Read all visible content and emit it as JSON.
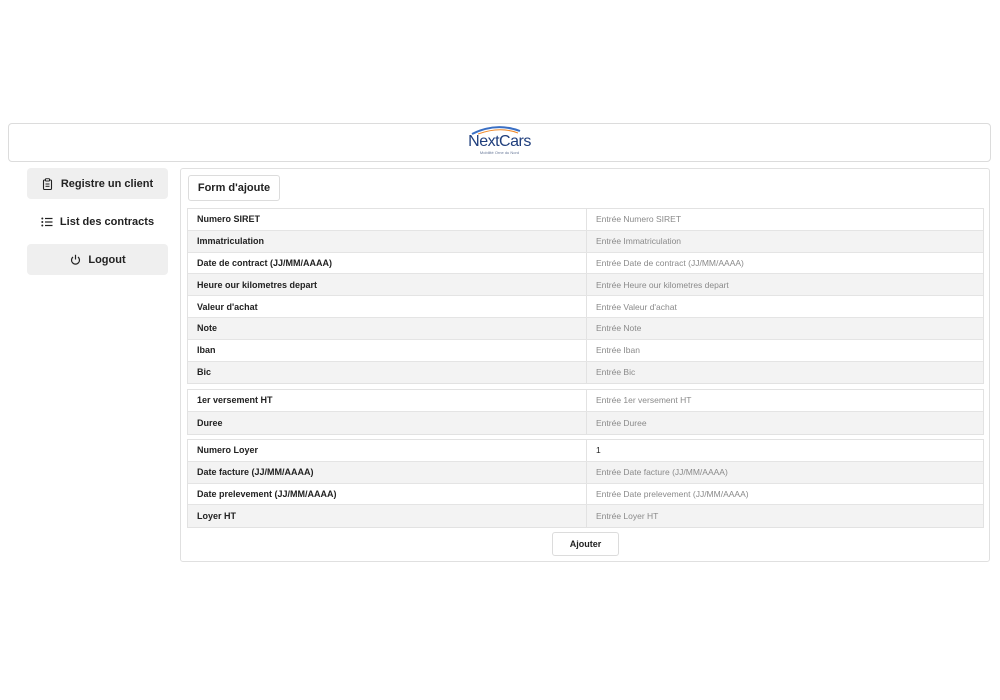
{
  "header": {
    "logo_text": "NextCars",
    "logo_tagline": "Mobilité Orne du Nord"
  },
  "sidebar": {
    "items": [
      {
        "label": "Registre un client",
        "icon": "clipboard-icon"
      },
      {
        "label": "List des contracts",
        "icon": "list-icon"
      },
      {
        "label": "Logout",
        "icon": "power-icon"
      }
    ]
  },
  "form": {
    "tab_label": "Form d'ajoute",
    "group1": [
      {
        "label": "Numero SIRET",
        "value": "",
        "placeholder": "Entrée Numero SIRET"
      },
      {
        "label": "Immatriculation",
        "value": "",
        "placeholder": "Entrée Immatriculation"
      },
      {
        "label": "Date de contract (JJ/MM/AAAA)",
        "value": "",
        "placeholder": "Entrée Date de contract (JJ/MM/AAAA)"
      },
      {
        "label": "Heure our kilometres depart",
        "value": "",
        "placeholder": "Entrée Heure our kilometres depart"
      },
      {
        "label": "Valeur d'achat",
        "value": "",
        "placeholder": "Entrée Valeur d'achat"
      },
      {
        "label": "Note",
        "value": "",
        "placeholder": "Entrée Note"
      },
      {
        "label": "Iban",
        "value": "",
        "placeholder": "Entrée Iban"
      },
      {
        "label": "Bic",
        "value": "",
        "placeholder": "Entrée Bic"
      }
    ],
    "group2": [
      {
        "label": "1er versement HT",
        "value": "",
        "placeholder": "Entrée 1er versement HT"
      },
      {
        "label": "Duree",
        "value": "",
        "placeholder": "Entrée Duree"
      }
    ],
    "group3": [
      {
        "label": "Numero Loyer",
        "value": "1",
        "placeholder": ""
      },
      {
        "label": "Date facture (JJ/MM/AAAA)",
        "value": "",
        "placeholder": "Entrée Date facture (JJ/MM/AAAA)"
      },
      {
        "label": "Date prelevement (JJ/MM/AAAA)",
        "value": "",
        "placeholder": "Entrée Date prelevement (JJ/MM/AAAA)"
      },
      {
        "label": "Loyer HT",
        "value": "",
        "placeholder": "Entrée Loyer HT"
      }
    ],
    "submit_label": "Ajouter"
  }
}
